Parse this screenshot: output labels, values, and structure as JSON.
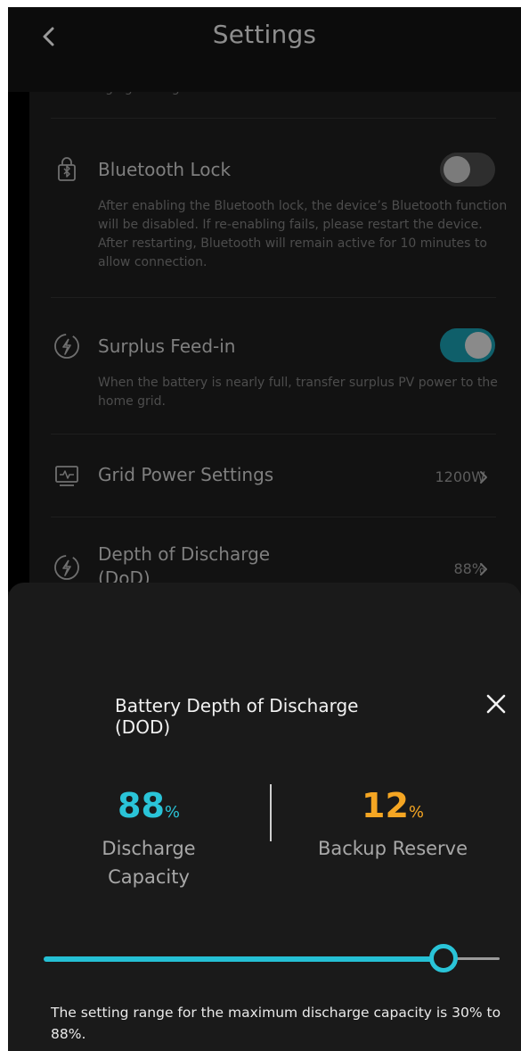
{
  "header": {
    "title": "Settings"
  },
  "settings": {
    "bluetooth_lock": {
      "title": "Bluetooth Lock",
      "description": "After enabling the Bluetooth lock, the device’s Bluetooth function will be disabled. If re-enabling fails, please restart the device. After restarting, Bluetooth will remain active for 10 minutes to allow connection.",
      "enabled": false
    },
    "surplus_feed_in": {
      "title": "Surplus Feed-in",
      "description": "When the battery is nearly full, transfer surplus PV power to the home grid.",
      "enabled": true
    },
    "grid_power": {
      "title": "Grid Power Settings",
      "value": "1200W"
    },
    "dod": {
      "title": "Depth of Discharge",
      "title_cut": "(DoD)",
      "value": "88%"
    }
  },
  "sheet": {
    "title": "Battery Depth of Discharge (DOD)",
    "discharge": {
      "value": "88",
      "unit": "%",
      "label_line1": "Discharge",
      "label_line2": "Capacity",
      "color": "#2ac4d8"
    },
    "reserve": {
      "value": "12",
      "unit": "%",
      "label": "Backup Reserve",
      "color": "#f5a623"
    },
    "slider": {
      "value_percent": 88,
      "min_percent": 30,
      "max_percent": 88
    },
    "note": "The setting range for the maximum discharge capacity is 30% to 88%."
  }
}
